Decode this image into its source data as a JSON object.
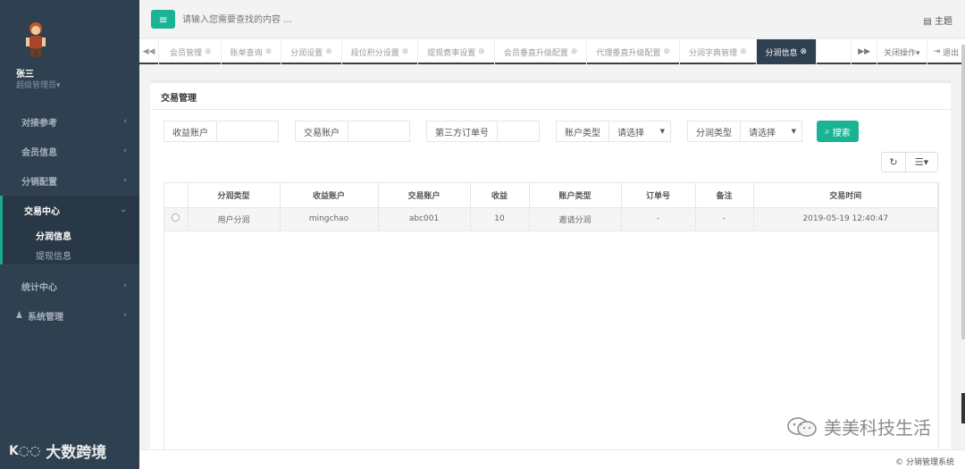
{
  "user": {
    "name": "张三",
    "role": "超级管理员▾"
  },
  "sidebar": {
    "items": [
      {
        "label": "对接参考"
      },
      {
        "label": "会员信息"
      },
      {
        "label": "分销配置"
      }
    ],
    "group": {
      "label": "交易中心",
      "children": [
        {
          "label": "分润信息"
        },
        {
          "label": "提现信息"
        }
      ]
    },
    "items_after": [
      {
        "label": "统计中心"
      },
      {
        "label": "系统管理"
      }
    ]
  },
  "topbar": {
    "search_placeholder": "请输入您需要查找的内容 …",
    "theme_label": "主题"
  },
  "tabs": [
    {
      "label": "会员管理"
    },
    {
      "label": "账单查询"
    },
    {
      "label": "分润设置"
    },
    {
      "label": "段位积分设置"
    },
    {
      "label": "提现费率设置"
    },
    {
      "label": "会员垂直升级配置"
    },
    {
      "label": "代理垂直升级配置"
    },
    {
      "label": "分润字典管理"
    },
    {
      "label": "分润信息"
    }
  ],
  "tab_controls": {
    "close_ops": "关闭操作▾",
    "logout": "退出"
  },
  "panel": {
    "title": "交易管理"
  },
  "filters": {
    "income_account": "收益账户",
    "trade_account": "交易账户",
    "third_order": "第三方订单号",
    "account_type": "账户类型",
    "account_type_value": "请选择",
    "profit_type": "分润类型",
    "profit_type_value": "请选择",
    "search_label": "搜索"
  },
  "table": {
    "headers": [
      "分润类型",
      "收益账户",
      "交易账户",
      "收益",
      "账户类型",
      "订单号",
      "备注",
      "交易时间"
    ],
    "rows": [
      [
        "用户分润",
        "mingchao",
        "abc001",
        "10",
        "邀请分润",
        "-",
        "-",
        "2019-05-19 12:40:47"
      ]
    ]
  },
  "footer": {
    "copyright": "© 分销管理系统"
  },
  "watermarks": {
    "left": "大数跨境",
    "right": "美美科技生活"
  },
  "colors": {
    "sidebar": "#2f4050",
    "accent": "#1ab394"
  }
}
